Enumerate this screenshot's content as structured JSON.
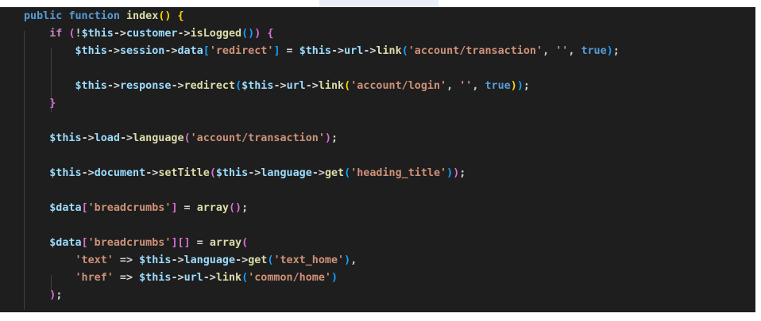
{
  "editor": {
    "lines": [
      {
        "tokens": [
          {
            "t": "public ",
            "c": "kw"
          },
          {
            "t": "function ",
            "c": "kw"
          },
          {
            "t": "index",
            "c": "fn"
          },
          {
            "t": "()",
            "c": "br1"
          },
          {
            "t": " ",
            "c": "pn"
          },
          {
            "t": "{",
            "c": "br1"
          }
        ]
      },
      {
        "tokens": [
          {
            "t": "    if ",
            "c": "ctl"
          },
          {
            "t": "(",
            "c": "br2"
          },
          {
            "t": "!",
            "c": "pn"
          },
          {
            "t": "$this",
            "c": "vr"
          },
          {
            "t": "->",
            "c": "pn"
          },
          {
            "t": "customer",
            "c": "vr"
          },
          {
            "t": "->",
            "c": "pn"
          },
          {
            "t": "isLogged",
            "c": "fn"
          },
          {
            "t": "()",
            "c": "br3"
          },
          {
            "t": ")",
            "c": "br2"
          },
          {
            "t": " ",
            "c": "pn"
          },
          {
            "t": "{",
            "c": "br2"
          }
        ]
      },
      {
        "tokens": [
          {
            "t": "        $this",
            "c": "vr"
          },
          {
            "t": "->",
            "c": "pn"
          },
          {
            "t": "session",
            "c": "vr"
          },
          {
            "t": "->",
            "c": "pn"
          },
          {
            "t": "data",
            "c": "vr"
          },
          {
            "t": "[",
            "c": "br3"
          },
          {
            "t": "'redirect'",
            "c": "st"
          },
          {
            "t": "]",
            "c": "br3"
          },
          {
            "t": " = ",
            "c": "pn"
          },
          {
            "t": "$this",
            "c": "vr"
          },
          {
            "t": "->",
            "c": "pn"
          },
          {
            "t": "url",
            "c": "vr"
          },
          {
            "t": "->",
            "c": "pn"
          },
          {
            "t": "link",
            "c": "fn"
          },
          {
            "t": "(",
            "c": "br3"
          },
          {
            "t": "'account/transaction'",
            "c": "st"
          },
          {
            "t": ", ",
            "c": "pn"
          },
          {
            "t": "''",
            "c": "st"
          },
          {
            "t": ", ",
            "c": "pn"
          },
          {
            "t": "true",
            "c": "kw"
          },
          {
            "t": ")",
            "c": "br3"
          },
          {
            "t": ";",
            "c": "pn"
          }
        ]
      },
      {
        "tokens": []
      },
      {
        "tokens": [
          {
            "t": "        $this",
            "c": "vr"
          },
          {
            "t": "->",
            "c": "pn"
          },
          {
            "t": "response",
            "c": "vr"
          },
          {
            "t": "->",
            "c": "pn"
          },
          {
            "t": "redirect",
            "c": "fn"
          },
          {
            "t": "(",
            "c": "br3"
          },
          {
            "t": "$this",
            "c": "vr"
          },
          {
            "t": "->",
            "c": "pn"
          },
          {
            "t": "url",
            "c": "vr"
          },
          {
            "t": "->",
            "c": "pn"
          },
          {
            "t": "link",
            "c": "fn"
          },
          {
            "t": "(",
            "c": "br1"
          },
          {
            "t": "'account/login'",
            "c": "st"
          },
          {
            "t": ", ",
            "c": "pn"
          },
          {
            "t": "''",
            "c": "st"
          },
          {
            "t": ", ",
            "c": "pn"
          },
          {
            "t": "true",
            "c": "kw"
          },
          {
            "t": ")",
            "c": "br1"
          },
          {
            "t": ")",
            "c": "br3"
          },
          {
            "t": ";",
            "c": "pn"
          }
        ]
      },
      {
        "tokens": [
          {
            "t": "    }",
            "c": "br2"
          }
        ]
      },
      {
        "tokens": []
      },
      {
        "tokens": [
          {
            "t": "    $this",
            "c": "vr"
          },
          {
            "t": "->",
            "c": "pn"
          },
          {
            "t": "load",
            "c": "vr"
          },
          {
            "t": "->",
            "c": "pn"
          },
          {
            "t": "language",
            "c": "fn"
          },
          {
            "t": "(",
            "c": "br2"
          },
          {
            "t": "'account/transaction'",
            "c": "st"
          },
          {
            "t": ")",
            "c": "br2"
          },
          {
            "t": ";",
            "c": "pn"
          }
        ]
      },
      {
        "tokens": []
      },
      {
        "tokens": [
          {
            "t": "    $this",
            "c": "vr"
          },
          {
            "t": "->",
            "c": "pn"
          },
          {
            "t": "document",
            "c": "vr"
          },
          {
            "t": "->",
            "c": "pn"
          },
          {
            "t": "setTitle",
            "c": "fn"
          },
          {
            "t": "(",
            "c": "br2"
          },
          {
            "t": "$this",
            "c": "vr"
          },
          {
            "t": "->",
            "c": "pn"
          },
          {
            "t": "language",
            "c": "vr"
          },
          {
            "t": "->",
            "c": "pn"
          },
          {
            "t": "get",
            "c": "fn"
          },
          {
            "t": "(",
            "c": "br3"
          },
          {
            "t": "'heading_title'",
            "c": "st"
          },
          {
            "t": ")",
            "c": "br3"
          },
          {
            "t": ")",
            "c": "br2"
          },
          {
            "t": ";",
            "c": "pn"
          }
        ]
      },
      {
        "tokens": []
      },
      {
        "tokens": [
          {
            "t": "    $data",
            "c": "vr"
          },
          {
            "t": "[",
            "c": "br2"
          },
          {
            "t": "'breadcrumbs'",
            "c": "st"
          },
          {
            "t": "]",
            "c": "br2"
          },
          {
            "t": " = ",
            "c": "pn"
          },
          {
            "t": "array",
            "c": "fn"
          },
          {
            "t": "()",
            "c": "br2"
          },
          {
            "t": ";",
            "c": "pn"
          }
        ]
      },
      {
        "tokens": []
      },
      {
        "tokens": [
          {
            "t": "    $data",
            "c": "vr"
          },
          {
            "t": "[",
            "c": "br2"
          },
          {
            "t": "'breadcrumbs'",
            "c": "st"
          },
          {
            "t": "]",
            "c": "br2"
          },
          {
            "t": "[]",
            "c": "br2"
          },
          {
            "t": " = ",
            "c": "pn"
          },
          {
            "t": "array",
            "c": "fn"
          },
          {
            "t": "(",
            "c": "br2"
          }
        ]
      },
      {
        "tokens": [
          {
            "t": "        'text'",
            "c": "st"
          },
          {
            "t": " => ",
            "c": "pn"
          },
          {
            "t": "$this",
            "c": "vr"
          },
          {
            "t": "->",
            "c": "pn"
          },
          {
            "t": "language",
            "c": "vr"
          },
          {
            "t": "->",
            "c": "pn"
          },
          {
            "t": "get",
            "c": "fn"
          },
          {
            "t": "(",
            "c": "br3"
          },
          {
            "t": "'text_home'",
            "c": "st"
          },
          {
            "t": ")",
            "c": "br3"
          },
          {
            "t": ",",
            "c": "pn"
          }
        ]
      },
      {
        "tokens": [
          {
            "t": "        'href'",
            "c": "st"
          },
          {
            "t": " => ",
            "c": "pn"
          },
          {
            "t": "$this",
            "c": "vr"
          },
          {
            "t": "->",
            "c": "pn"
          },
          {
            "t": "url",
            "c": "vr"
          },
          {
            "t": "->",
            "c": "pn"
          },
          {
            "t": "link",
            "c": "fn"
          },
          {
            "t": "(",
            "c": "br3"
          },
          {
            "t": "'common/home'",
            "c": "st"
          },
          {
            "t": ")",
            "c": "br3"
          }
        ]
      },
      {
        "tokens": [
          {
            "t": "    )",
            "c": "br2"
          },
          {
            "t": ";",
            "c": "pn"
          }
        ]
      }
    ]
  }
}
